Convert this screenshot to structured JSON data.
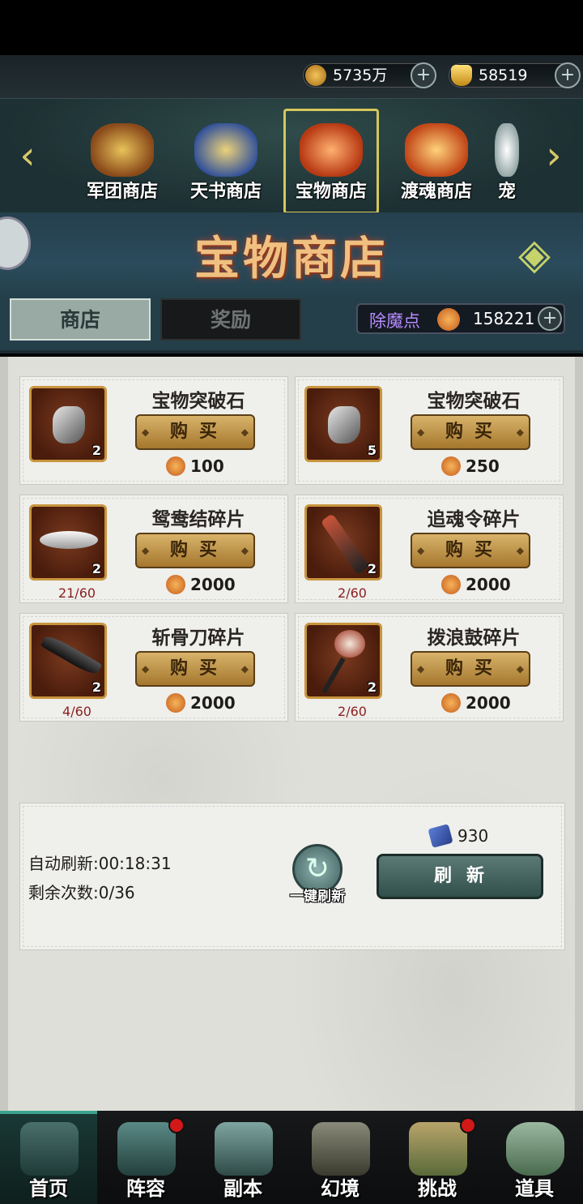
{
  "currencies": {
    "coins": "5735万",
    "gold": "58519"
  },
  "shops": [
    {
      "label": "军团商店"
    },
    {
      "label": "天书商店"
    },
    {
      "label": "宝物商店"
    },
    {
      "label": "渡魂商店"
    },
    {
      "label": "宠"
    }
  ],
  "banner": {
    "title": "宝物商店"
  },
  "tabs": {
    "shop": "商店",
    "reward": "奖励"
  },
  "points": {
    "label": "除魔点",
    "value": "158221"
  },
  "items": [
    {
      "name": "宝物突破石",
      "qty": "2",
      "buy": "购买",
      "price": "100",
      "progress": ""
    },
    {
      "name": "宝物突破石",
      "qty": "5",
      "buy": "购买",
      "price": "250",
      "progress": ""
    },
    {
      "name": "鸳鸯结碎片",
      "qty": "2",
      "buy": "购买",
      "price": "2000",
      "progress": "21/60"
    },
    {
      "name": "追魂令碎片",
      "qty": "2",
      "buy": "购买",
      "price": "2000",
      "progress": "2/60"
    },
    {
      "name": "斩骨刀碎片",
      "qty": "2",
      "buy": "购买",
      "price": "2000",
      "progress": "4/60"
    },
    {
      "name": "拨浪鼓碎片",
      "qty": "2",
      "buy": "购买",
      "price": "2000",
      "progress": "2/60"
    }
  ],
  "refresh": {
    "auto": "自动刷新:00:18:31",
    "remaining": "剩余次数:0/36",
    "onekey": "一键刷新",
    "cost": "930",
    "button": "刷新"
  },
  "nav": [
    {
      "label": "首页"
    },
    {
      "label": "阵容"
    },
    {
      "label": "副本"
    },
    {
      "label": "幻境"
    },
    {
      "label": "挑战"
    },
    {
      "label": "道具"
    }
  ],
  "colors": {
    "accent_gold": "#d4c85a",
    "buy_button": "#c79a4a",
    "points_label": "#b88bff",
    "progress_red": "#8b1e1e",
    "notification_red": "#d21818"
  }
}
